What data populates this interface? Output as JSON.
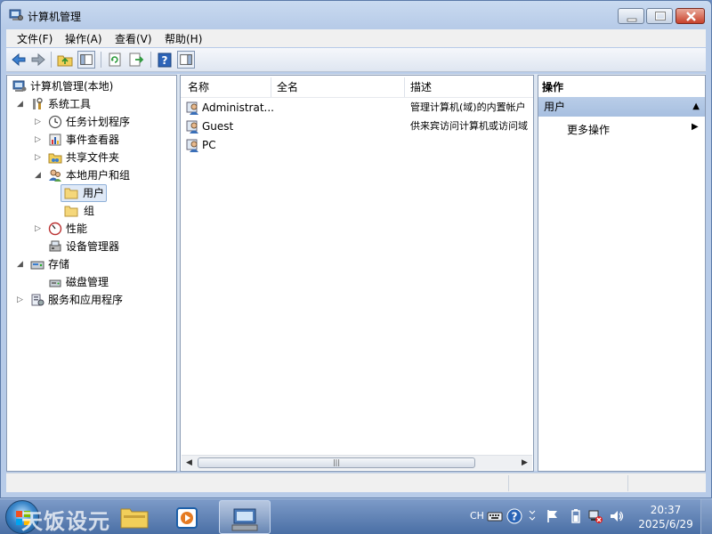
{
  "window": {
    "title": "计算机管理"
  },
  "menu": [
    "文件(F)",
    "操作(A)",
    "查看(V)",
    "帮助(H)"
  ],
  "tree": [
    {
      "label": "计算机管理(本地)",
      "icon": "computer-management-icon"
    },
    {
      "label": "系统工具",
      "icon": "tools-icon"
    },
    {
      "label": "任务计划程序",
      "icon": "clock-icon"
    },
    {
      "label": "事件查看器",
      "icon": "event-viewer-icon"
    },
    {
      "label": "共享文件夹",
      "icon": "shared-folder-icon"
    },
    {
      "label": "本地用户和组",
      "icon": "users-icon"
    },
    {
      "label": "用户",
      "icon": "folder-icon"
    },
    {
      "label": "组",
      "icon": "folder-icon"
    },
    {
      "label": "性能",
      "icon": "performance-icon"
    },
    {
      "label": "设备管理器",
      "icon": "device-manager-icon"
    },
    {
      "label": "存储",
      "icon": "storage-icon"
    },
    {
      "label": "磁盘管理",
      "icon": "disk-icon"
    },
    {
      "label": "服务和应用程序",
      "icon": "services-icon"
    }
  ],
  "list": {
    "columns": [
      "名称",
      "全名",
      "描述"
    ],
    "rows": [
      {
        "name": "Administrat...",
        "fullname": "",
        "description": "管理计算机(域)的内置帐户"
      },
      {
        "name": "Guest",
        "fullname": "",
        "description": "供来宾访问计算机或访问域"
      },
      {
        "name": "PC",
        "fullname": "",
        "description": ""
      }
    ]
  },
  "actions": {
    "title": "操作",
    "section": "用户",
    "more": "更多操作"
  },
  "taskbar": {
    "watermark": "天饭设元",
    "lang": "CH",
    "time": "20:37",
    "date": "2025/6/29"
  }
}
